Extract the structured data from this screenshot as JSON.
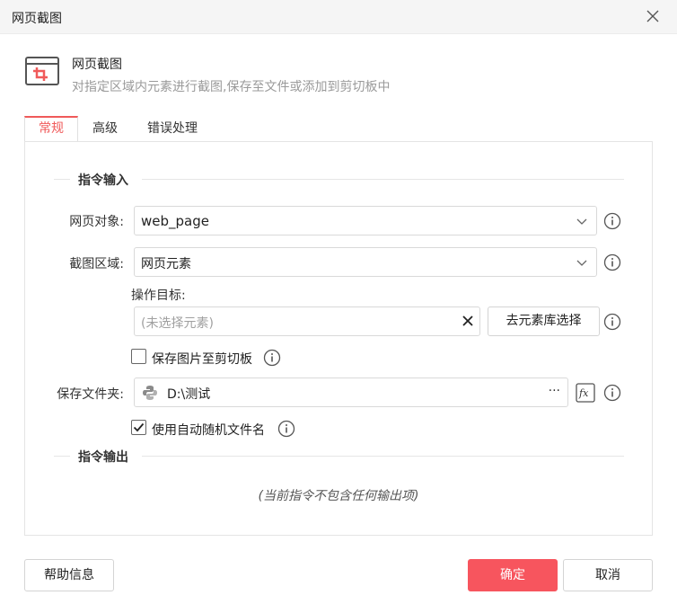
{
  "window": {
    "title": "网页截图"
  },
  "header": {
    "name": "网页截图",
    "description": "对指定区域内元素进行截图,保存至文件或添加到剪切板中"
  },
  "tabs": [
    {
      "label": "常规",
      "active": true
    },
    {
      "label": "高级",
      "active": false
    },
    {
      "label": "错误处理",
      "active": false
    }
  ],
  "input_section": {
    "title": "指令输入",
    "web_object": {
      "label": "网页对象:",
      "value": "web_page"
    },
    "capture_area": {
      "label": "截图区域:",
      "value": "网页元素"
    },
    "target": {
      "label": "操作目标:",
      "placeholder": "(未选择元素)",
      "library_button": "去元素库选择"
    },
    "save_clipboard": {
      "label": "保存图片至剪切板",
      "checked": false
    },
    "save_folder": {
      "label": "保存文件夹:",
      "value": "D:\\测试",
      "more": "···"
    },
    "auto_filename": {
      "label": "使用自动随机文件名",
      "checked": true
    }
  },
  "output_section": {
    "title": "指令输出",
    "empty_text": "(当前指令不包含任何输出项)"
  },
  "footer": {
    "help": "帮助信息",
    "ok": "确定",
    "cancel": "取消"
  },
  "colors": {
    "accent": "#f05a5a",
    "primary_button": "#f7555e"
  },
  "icons": [
    "close-icon",
    "crop-screenshot-icon",
    "chevron-down-icon",
    "info-icon",
    "clear-icon",
    "python-icon",
    "fx-icon",
    "check-icon"
  ]
}
